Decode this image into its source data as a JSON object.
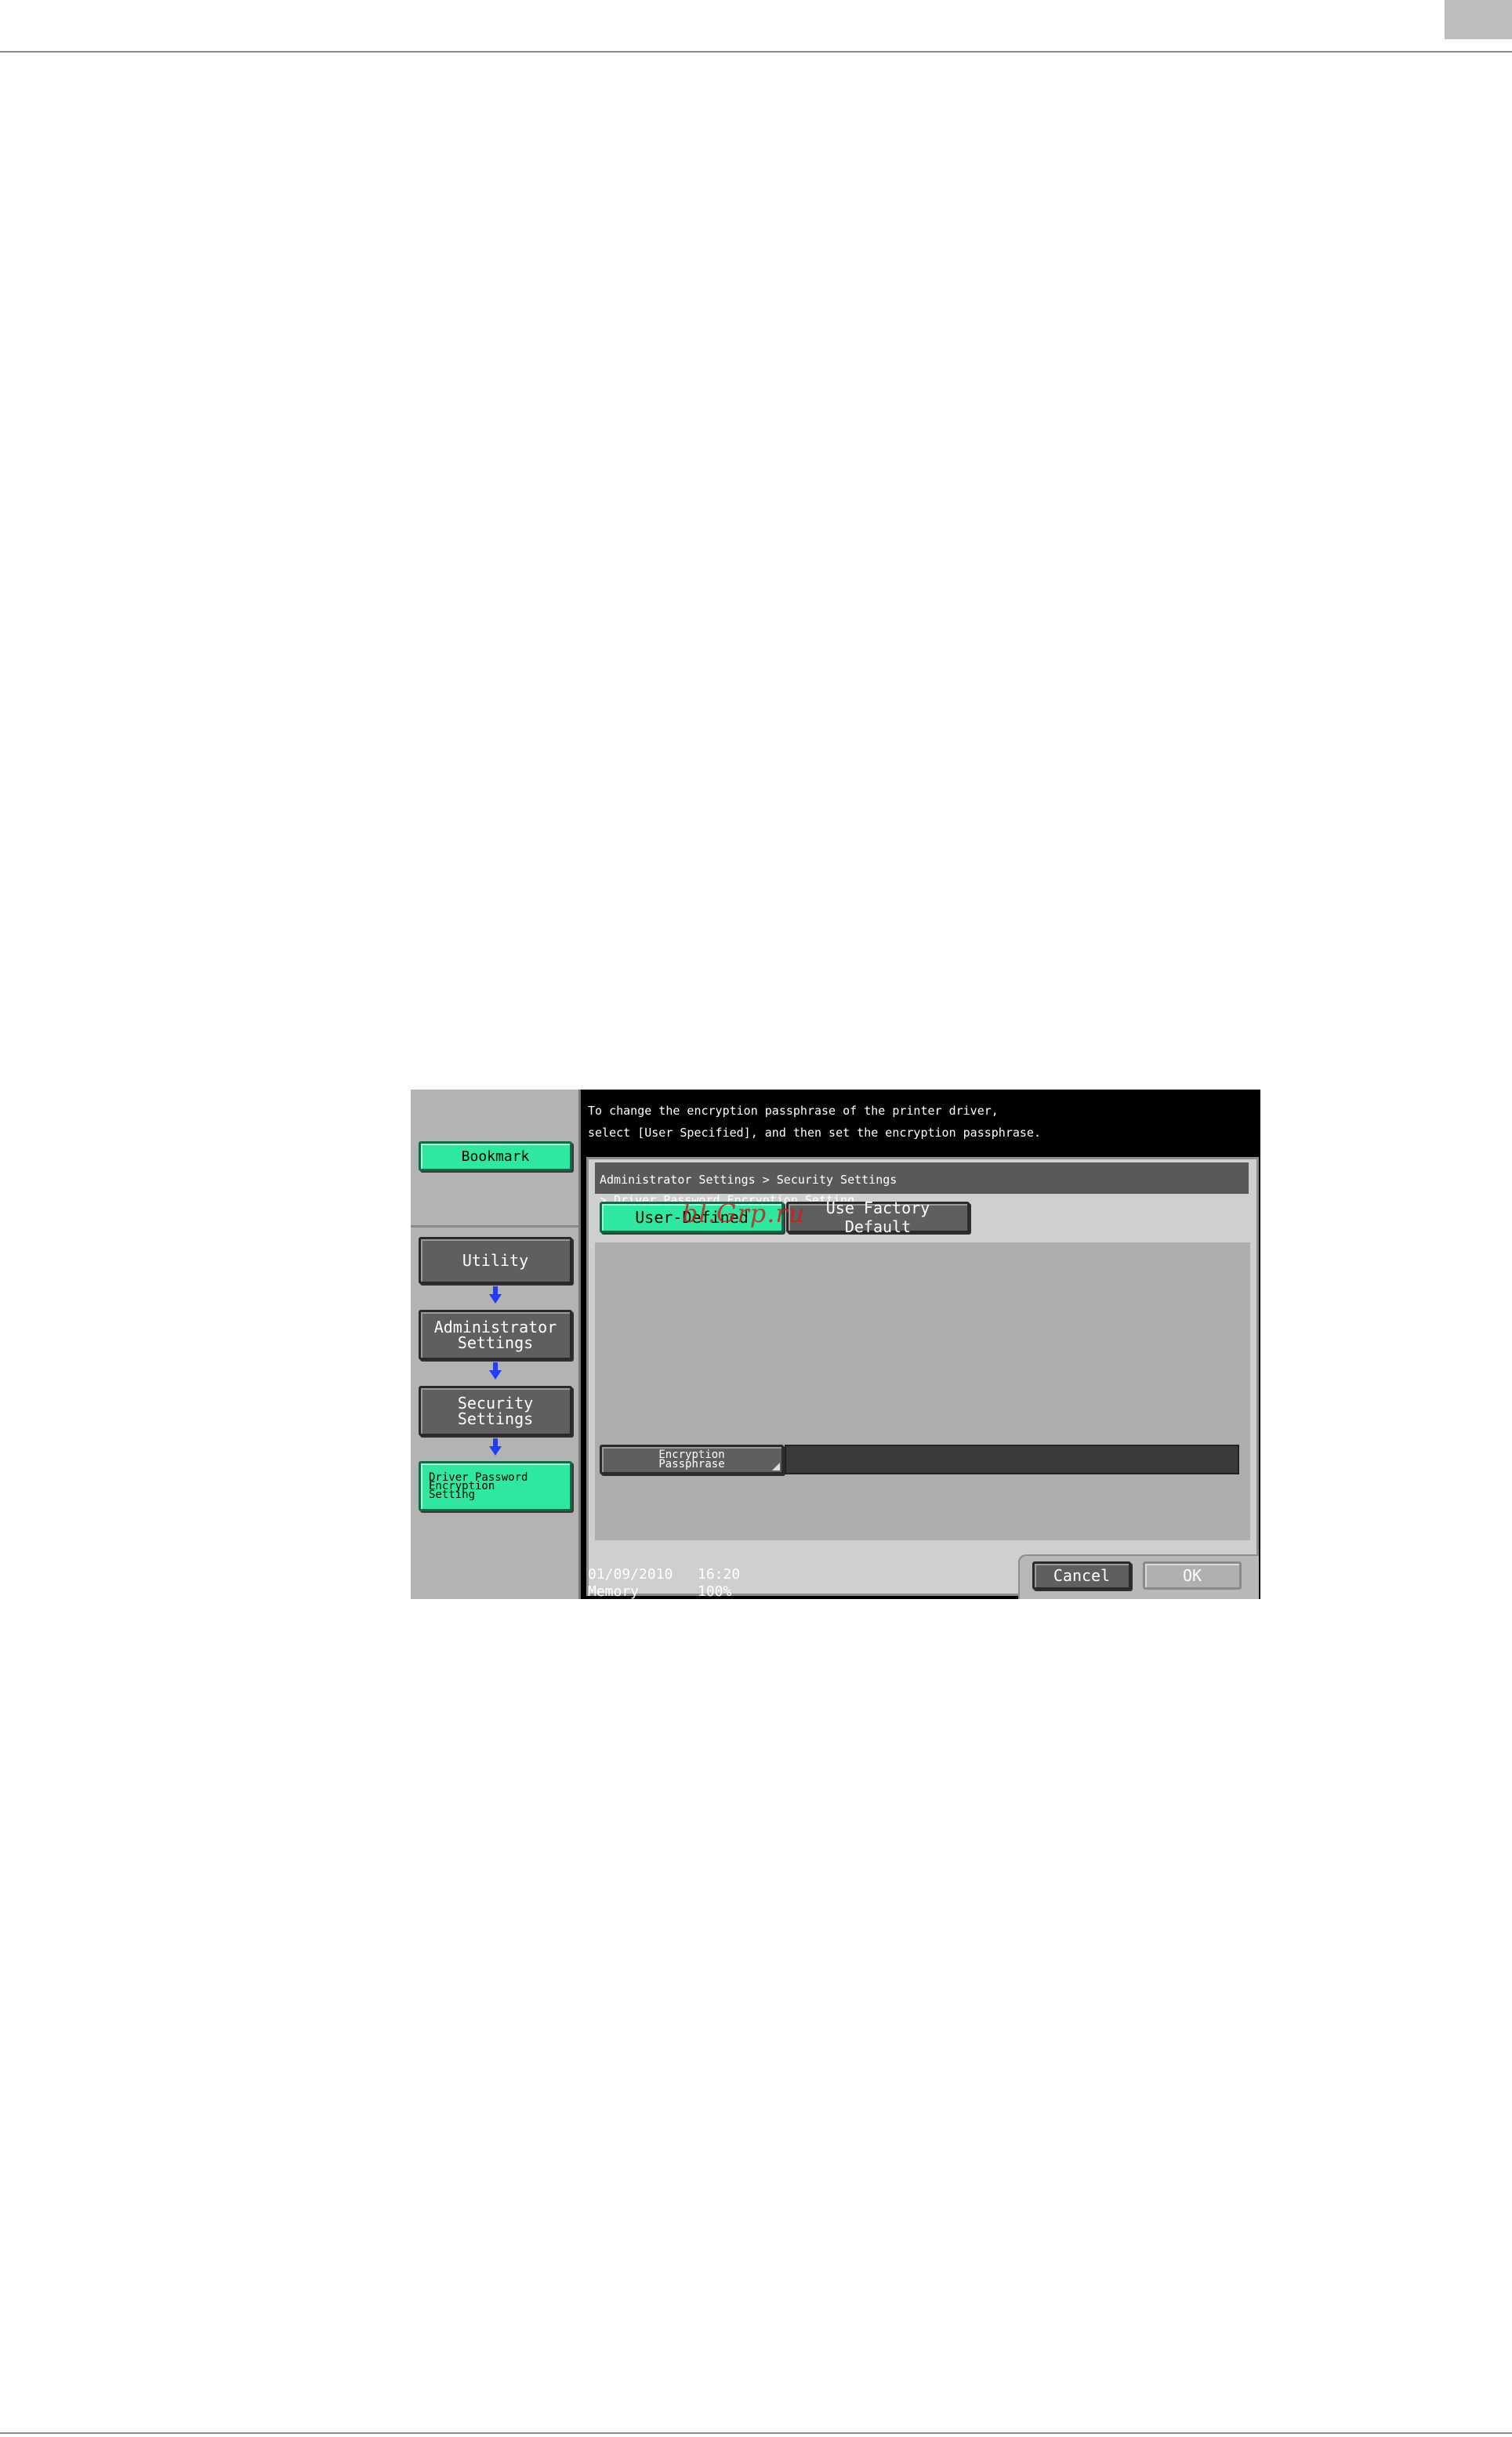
{
  "message": {
    "line1": "To change the encryption passphrase of the printer driver,",
    "line2": "select [User Specified], and then set the encryption passphrase."
  },
  "sidebar": {
    "bookmark_label": "Bookmark",
    "nav": [
      {
        "label": "Utility",
        "state": "inactive"
      },
      {
        "label": "Administrator\nSettings",
        "state": "inactive"
      },
      {
        "label": "Security\nSettings",
        "state": "inactive"
      },
      {
        "label": "Driver Password\nEncryption\nSetting",
        "state": "active"
      }
    ]
  },
  "breadcrumb": {
    "line1": "Administrator Settings > Security Settings",
    "line2": "> Driver Password Encryption Setting"
  },
  "options": {
    "user_defined": "User-Defined",
    "factory_default": "Use Factory Default",
    "selected": "User-Defined"
  },
  "passphrase": {
    "label": "Encryption\nPassphrase",
    "value": ""
  },
  "status": {
    "date": "01/09/2010",
    "time": "16:20",
    "memory_label": "Memory",
    "memory_value": "100%"
  },
  "footer": {
    "cancel_label": "Cancel",
    "ok_label": "OK"
  },
  "watermark": "bl.Grp.ru",
  "colors": {
    "accent_green": "#2ee8a0",
    "button_gray": "#5f5f5f",
    "panel_gray": "#b3b3b3",
    "screen_black": "#000000",
    "arrow_blue": "#1f3cff"
  }
}
